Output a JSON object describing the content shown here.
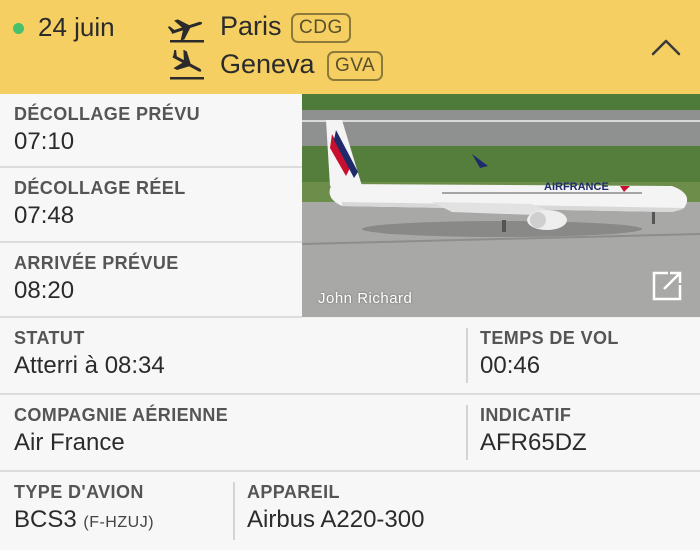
{
  "header": {
    "date": "24 juin",
    "departure": {
      "city": "Paris",
      "code": "CDG"
    },
    "arrival": {
      "city": "Geneva",
      "code": "GVA"
    },
    "status_color": "#45c26b",
    "background": "#f5cf62"
  },
  "times": {
    "scheduled_takeoff": {
      "label": "DÉCOLLAGE PRÉVU",
      "value": "07:10"
    },
    "actual_takeoff": {
      "label": "DÉCOLLAGE RÉEL",
      "value": "07:48"
    },
    "scheduled_arrival": {
      "label": "ARRIVÉE PRÉVUE",
      "value": "08:20"
    }
  },
  "photo": {
    "credit": "John Richard",
    "livery_text": "AIRFRANCE"
  },
  "status": {
    "label": "STATUT",
    "value": "Atterri à 08:34"
  },
  "flight_time": {
    "label": "TEMPS DE VOL",
    "value": "00:46"
  },
  "airline": {
    "label": "COMPAGNIE AÉRIENNE",
    "value": "Air France"
  },
  "callsign": {
    "label": "INDICATIF",
    "value": "AFR65DZ"
  },
  "aircraft_type": {
    "label": "TYPE D'AVION",
    "value": "BCS3",
    "registration": "(F-HZUJ)"
  },
  "aircraft": {
    "label": "APPAREIL",
    "value": "Airbus A220-300"
  },
  "icons": [
    "status-dot",
    "takeoff-plane-icon",
    "landing-plane-icon",
    "chevron-up-icon",
    "external-link-icon"
  ]
}
